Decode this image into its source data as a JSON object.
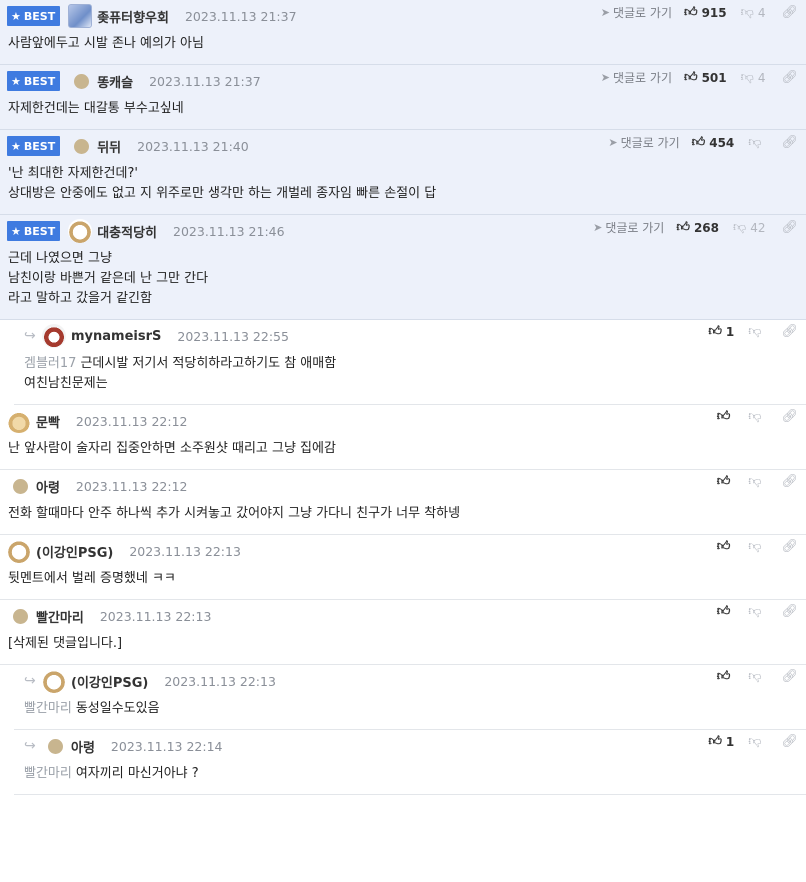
{
  "labels": {
    "best": "BEST",
    "goto": "댓글로 가기"
  },
  "comments": [
    {
      "best": true,
      "reply": false,
      "avatar": "img",
      "nick": "좆퓨터향우회",
      "date": "2023.11.13 21:37",
      "goto": true,
      "up": "915",
      "down": "4",
      "lines": [
        "사람앞에두고 시발 존나 예의가 아님"
      ]
    },
    {
      "best": true,
      "reply": false,
      "avatar": "dot",
      "nick": "똥캐슬",
      "date": "2023.11.13 21:37",
      "goto": true,
      "up": "501",
      "down": "4",
      "lines": [
        "자제한건데는 대갈통 부수고싶네"
      ]
    },
    {
      "best": true,
      "reply": false,
      "avatar": "dot",
      "nick": "뒤뒤",
      "date": "2023.11.13 21:40",
      "goto": true,
      "up": "454",
      "down": "",
      "lines": [
        "'난 최대한 자제한건데?'",
        "상대방은 안중에도 없고 지 위주로만 생각만 하는 개벌레 종자임 빠른 손절이 답"
      ]
    },
    {
      "best": true,
      "reply": false,
      "avatar": "dog",
      "nick": "대충적당히",
      "date": "2023.11.13 21:46",
      "goto": true,
      "up": "268",
      "down": "42",
      "lines": [
        "근데 나였으면 그냥",
        "남친이랑 바쁜거 같은데 난 그만 간다",
        "라고 말하고 갔을거 같긴함"
      ]
    },
    {
      "best": false,
      "reply": true,
      "avatar": "puppy",
      "nick": "mynameisrS",
      "date": "2023.11.13 22:55",
      "goto": false,
      "up": "1",
      "down": "",
      "mention": "겜블러17",
      "lines": [
        "근데시발 저기서 적당히하라고하기도 참 애매함",
        "여친남친문제는"
      ]
    },
    {
      "best": false,
      "reply": false,
      "avatar": "dog2",
      "nick": "문빡",
      "date": "2023.11.13 22:12",
      "goto": false,
      "up": "",
      "down": "",
      "lines": [
        "난 앞사람이 술자리 집중안하면 소주원샷 때리고 그냥 집에감"
      ]
    },
    {
      "best": false,
      "reply": false,
      "avatar": "dot",
      "nick": "아령",
      "date": "2023.11.13 22:12",
      "goto": false,
      "up": "",
      "down": "",
      "lines": [
        "전화 할때마다 안주 하나씩 추가 시켜놓고 갔어야지 그냥 가다니 친구가 너무 착하넹"
      ]
    },
    {
      "best": false,
      "reply": false,
      "avatar": "dog",
      "nick": "(이강인PSG)",
      "date": "2023.11.13 22:13",
      "goto": false,
      "up": "",
      "down": "",
      "lines": [
        "뒷멘트에서 벌레 증명했네 ㅋㅋ"
      ]
    },
    {
      "best": false,
      "reply": false,
      "avatar": "dot",
      "nick": "빨간마리",
      "date": "2023.11.13 22:13",
      "goto": false,
      "up": "",
      "down": "",
      "lines": [
        "[삭제된 댓글입니다.]"
      ]
    },
    {
      "best": false,
      "reply": true,
      "avatar": "dog",
      "nick": "(이강인PSG)",
      "date": "2023.11.13 22:13",
      "goto": false,
      "up": "",
      "down": "",
      "mention": "빨간마리",
      "lines": [
        "동성일수도있음"
      ]
    },
    {
      "best": false,
      "reply": true,
      "avatar": "dot",
      "nick": "아령",
      "date": "2023.11.13 22:14",
      "goto": false,
      "up": "1",
      "down": "",
      "mention": "빨간마리",
      "lines": [
        "여자끼리 마신거아냐 ?"
      ]
    }
  ]
}
